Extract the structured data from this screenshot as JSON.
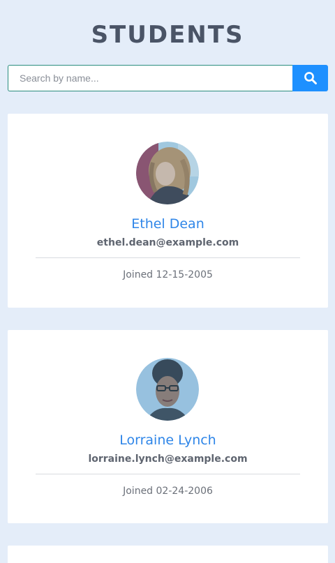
{
  "header": {
    "title": "STUDENTS"
  },
  "search": {
    "placeholder": "Search by name...",
    "value": "",
    "button_icon": "search-icon"
  },
  "students": [
    {
      "name": "Ethel Dean",
      "email": "ethel.dean@example.com",
      "joined": "Joined 12-15-2005"
    },
    {
      "name": "Lorraine Lynch",
      "email": "lorraine.lynch@example.com",
      "joined": "Joined 02-24-2006"
    }
  ],
  "colors": {
    "background": "#e4edf9",
    "accent": "#1e90ff",
    "name_text": "#2f86e8",
    "title_text": "#4a5466"
  }
}
